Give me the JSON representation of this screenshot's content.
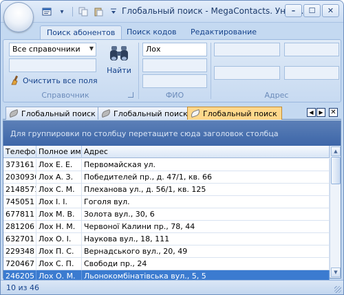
{
  "window": {
    "title": "Глобальный поиск - MegaContacts. Унив...",
    "controls": {
      "minimize": "–",
      "restore": "☐",
      "close": "✕"
    }
  },
  "ribbon_tabs": [
    {
      "label": "Поиск абонентов",
      "active": true
    },
    {
      "label": "Поиск кодов",
      "active": false
    },
    {
      "label": "Редактирование",
      "active": false
    }
  ],
  "ribbon": {
    "directory_combo": "Все справочники",
    "clear_all_label": "Очистить все поля",
    "find_label": "Найти",
    "group_directory": "Справочник",
    "fio_value": "Лох",
    "group_fio": "ФИО",
    "group_address": "Адрес"
  },
  "doc_tabs": [
    {
      "label": "Глобальный поиск",
      "active": false
    },
    {
      "label": "Глобальный поиск",
      "active": false
    },
    {
      "label": "Глобальный поиск",
      "active": true
    }
  ],
  "grid": {
    "group_hint": "Для группировки по столбцу перетащите сюда заголовок столбца",
    "columns": [
      "Телефон",
      "Полное имя",
      "Адрес"
    ],
    "rows": [
      {
        "phone": "373161",
        "name": "Лох Е. Е.",
        "address": "Первомайская ул."
      },
      {
        "phone": "2030936",
        "name": "Лох А. З.",
        "address": "Победителей пр., д. 47/1, кв. 66"
      },
      {
        "phone": "2148571",
        "name": "Лох С. М.",
        "address": "Плеханова ул., д. 56/1, кв. 125"
      },
      {
        "phone": "745051",
        "name": "Лох І. І.",
        "address": "Гоголя вул."
      },
      {
        "phone": "677811",
        "name": "Лох М. В.",
        "address": "Золота вул., 30, 6"
      },
      {
        "phone": "281206",
        "name": "Лох Н. М.",
        "address": "Червоної Калини пр., 78, 44"
      },
      {
        "phone": "632701",
        "name": "Лох О. І.",
        "address": "Наукова вул., 18, 111"
      },
      {
        "phone": "229348",
        "name": "Лох П. С.",
        "address": "Вернадського вул., 20, 49"
      },
      {
        "phone": "720467",
        "name": "Лох С. П.",
        "address": "Свободи пр., 24"
      },
      {
        "phone": "246205",
        "name": "Лох О. М.",
        "address": "Льонокомбінатівська вул., 5, 5",
        "selected": true
      }
    ]
  },
  "status": {
    "text": "10 из 46"
  },
  "colors": {
    "accent": "#3b7bd0",
    "ribbon": "#c4d9f1",
    "active_tab": "#ffd88b",
    "group_panel": "#4a70b0"
  }
}
